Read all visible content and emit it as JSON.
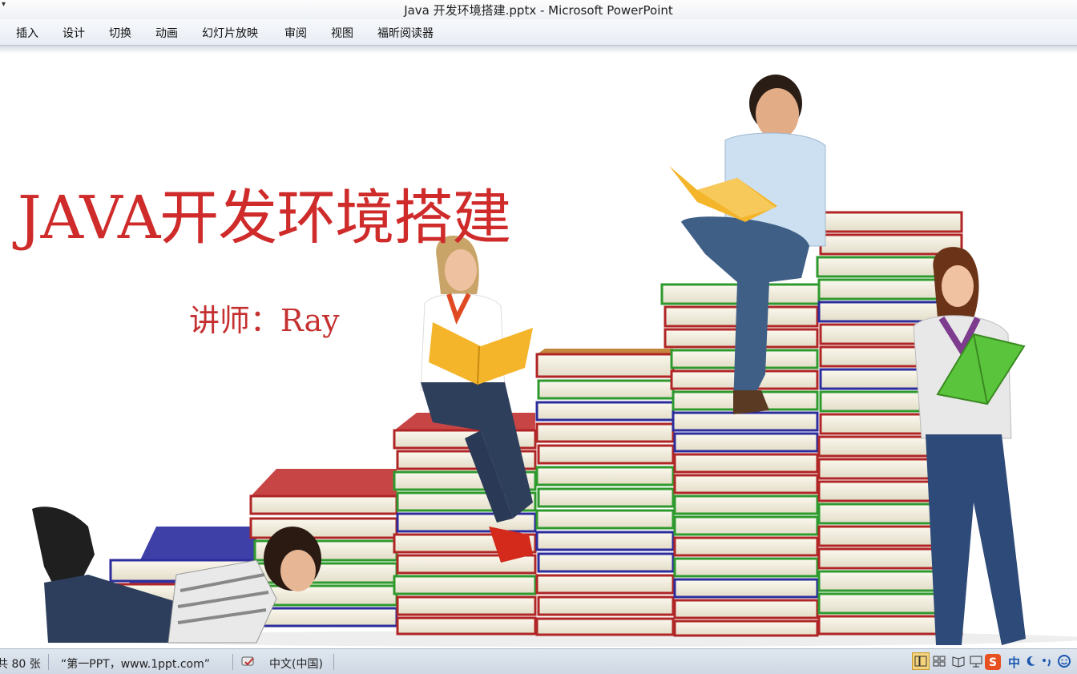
{
  "window": {
    "title": "Java 开发环境搭建.pptx - Microsoft PowerPoint",
    "quick_access_glyph": "▾"
  },
  "ribbon": {
    "tabs": [
      "插入",
      "设计",
      "切换",
      "动画",
      "幻灯片放映",
      "审阅",
      "视图",
      "福昕阅读器"
    ]
  },
  "slide": {
    "title": "JAVA开发环境搭建",
    "subtitle": "讲师：Ray",
    "title_color": "#cf2b2b"
  },
  "statusbar": {
    "slide_count": "共 80 张",
    "theme": "“第一PPT，www.1ppt.com”",
    "language": "中文(中国)",
    "ime_char": "中",
    "accent": "#3b6db3"
  }
}
